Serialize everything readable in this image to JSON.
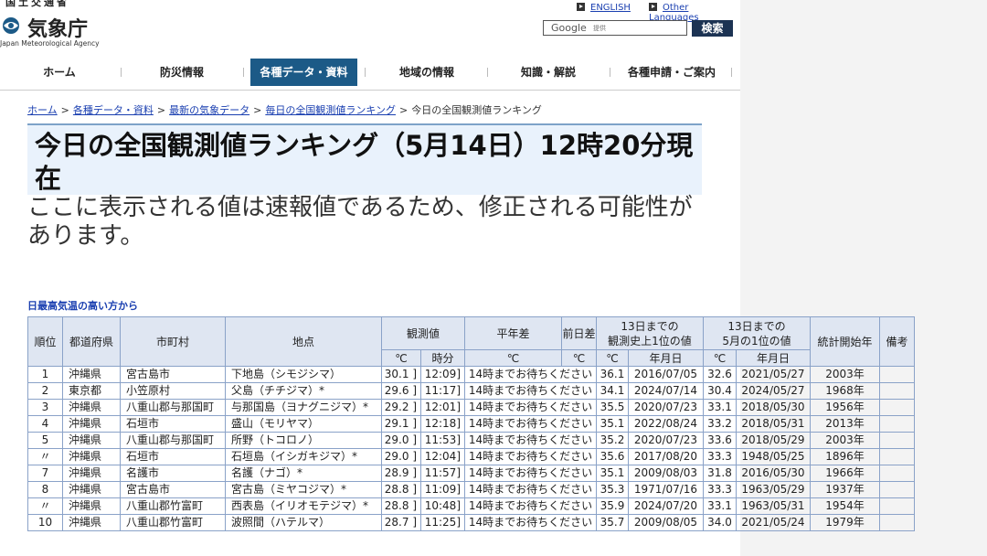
{
  "header": {
    "logo_top": "国土交通省",
    "logo_name": "気象庁",
    "logo_en": "Japan Meteorological Agency",
    "lang_english": "ENGLISH",
    "lang_other": "Other Languages",
    "search_logo": "Google",
    "search_provided": "提供",
    "search_button": "検索"
  },
  "nav": [
    "ホーム",
    "防災情報",
    "各種データ・資料",
    "地域の情報",
    "知識・解説",
    "各種申請・ご案内"
  ],
  "breadcrumb": {
    "items": [
      "ホーム",
      "各種データ・資料",
      "最新の気象データ",
      "毎日の全国観測値ランキング"
    ],
    "current": "今日の全国観測値ランキング"
  },
  "title": "今日の全国観測値ランキング（5月14日）12時20分現在",
  "note": "ここに表示される値は速報値であるため、修正される可能性があります。",
  "section_title": "日最高気温の高い方から",
  "table": {
    "headers": {
      "rank": "順位",
      "pref": "都道府県",
      "city": "市町村",
      "station": "地点",
      "obs": "観測値",
      "normal_diff": "平年差",
      "prev_diff": "前日差",
      "hist_record": "13日までの\n観測史上1位の値",
      "may_record": "13日までの\n5月の1位の値",
      "start_year": "統計開始年",
      "remarks": "備考"
    },
    "subheaders": {
      "obs_c": "℃",
      "obs_time": "時分",
      "normal_c": "℃",
      "prev_c": "℃",
      "hist_c": "℃",
      "hist_date": "年月日",
      "may_c": "℃",
      "may_date": "年月日"
    },
    "rows": [
      {
        "rank": "1",
        "pref": "沖縄県",
        "city": "宮古島市",
        "station": "下地島（シモジシマ）",
        "obs": "30.1 ]",
        "time": "12:09]",
        "normal": "14時までお待ちください",
        "prev": "",
        "hist": "36.1",
        "hist_date": "2016/07/05",
        "may": "32.6",
        "may_date": "2021/05/27",
        "start": "2003年",
        "remarks": ""
      },
      {
        "rank": "2",
        "pref": "東京都",
        "city": "小笠原村",
        "station": "父島（チチジマ）*",
        "obs": "29.6 ]",
        "time": "11:17]",
        "normal": "14時までお待ちください",
        "prev": "",
        "hist": "34.1",
        "hist_date": "2024/07/14",
        "may": "30.4",
        "may_date": "2024/05/27",
        "start": "1968年",
        "remarks": ""
      },
      {
        "rank": "3",
        "pref": "沖縄県",
        "city": "八重山郡与那国町",
        "station": "与那国島（ヨナグニジマ）*",
        "obs": "29.2 ]",
        "time": "12:01]",
        "normal": "14時までお待ちください",
        "prev": "",
        "hist": "35.5",
        "hist_date": "2020/07/23",
        "may": "33.1",
        "may_date": "2018/05/30",
        "start": "1956年",
        "remarks": ""
      },
      {
        "rank": "4",
        "pref": "沖縄県",
        "city": "石垣市",
        "station": "盛山（モリヤマ）",
        "obs": "29.1 ]",
        "time": "12:18]",
        "normal": "14時までお待ちください",
        "prev": "",
        "hist": "35.1",
        "hist_date": "2022/08/24",
        "may": "33.2",
        "may_date": "2018/05/31",
        "start": "2013年",
        "remarks": ""
      },
      {
        "rank": "5",
        "pref": "沖縄県",
        "city": "八重山郡与那国町",
        "station": "所野（トコロノ）",
        "obs": "29.0 ]",
        "time": "11:53]",
        "normal": "14時までお待ちください",
        "prev": "",
        "hist": "35.2",
        "hist_date": "2020/07/23",
        "may": "33.6",
        "may_date": "2018/05/29",
        "start": "2003年",
        "remarks": ""
      },
      {
        "rank": "〃",
        "pref": "沖縄県",
        "city": "石垣市",
        "station": "石垣島（イシガキジマ）*",
        "obs": "29.0 ]",
        "time": "12:04]",
        "normal": "14時までお待ちください",
        "prev": "",
        "hist": "35.6",
        "hist_date": "2017/08/20",
        "may": "33.3",
        "may_date": "1948/05/25",
        "start": "1896年",
        "remarks": ""
      },
      {
        "rank": "7",
        "pref": "沖縄県",
        "city": "名護市",
        "station": "名護（ナゴ）*",
        "obs": "28.9 ]",
        "time": "11:57]",
        "normal": "14時までお待ちください",
        "prev": "",
        "hist": "35.1",
        "hist_date": "2009/08/03",
        "may": "31.8",
        "may_date": "2016/05/30",
        "start": "1966年",
        "remarks": ""
      },
      {
        "rank": "8",
        "pref": "沖縄県",
        "city": "宮古島市",
        "station": "宮古島（ミヤコジマ）*",
        "obs": "28.8 ]",
        "time": "11:09]",
        "normal": "14時までお待ちください",
        "prev": "",
        "hist": "35.3",
        "hist_date": "1971/07/16",
        "may": "33.3",
        "may_date": "1963/05/29",
        "start": "1937年",
        "remarks": ""
      },
      {
        "rank": "〃",
        "pref": "沖縄県",
        "city": "八重山郡竹富町",
        "station": "西表島（イリオモテジマ）*",
        "obs": "28.8 ]",
        "time": "10:48]",
        "normal": "14時までお待ちください",
        "prev": "",
        "hist": "35.9",
        "hist_date": "2024/07/20",
        "may": "33.1",
        "may_date": "1963/05/31",
        "start": "1954年",
        "remarks": ""
      },
      {
        "rank": "10",
        "pref": "沖縄県",
        "city": "八重山郡竹富町",
        "station": "波照間（ハテルマ）",
        "obs": "28.7 ]",
        "time": "11:25]",
        "normal": "14時までお待ちください",
        "prev": "",
        "hist": "35.7",
        "hist_date": "2009/08/05",
        "may": "34.0",
        "may_date": "2021/05/24",
        "start": "1979年",
        "remarks": ""
      }
    ]
  },
  "colors": {
    "nav_active": "#1c5a87",
    "link": "#1a3fb0",
    "table_header_bg": "#dfe6f2",
    "table_border": "#8aa2c8",
    "title_bg": "#e9f2fc",
    "search_button_bg": "#1c3353"
  }
}
